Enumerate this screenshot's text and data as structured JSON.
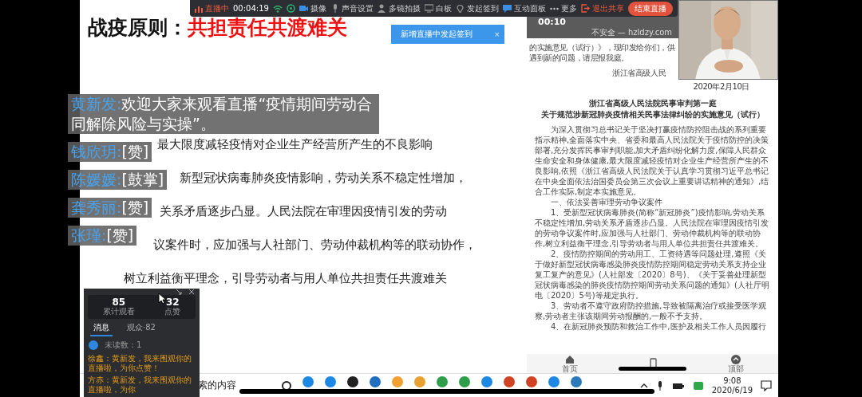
{
  "toolbar": {
    "live_status": "直播中",
    "elapsed": "00:04:19",
    "items": [
      {
        "label": "摄像"
      },
      {
        "label": "声音设置"
      },
      {
        "label": "多镜拍摄"
      },
      {
        "label": "白板"
      },
      {
        "label": "发起签到"
      },
      {
        "label": "互动面板"
      },
      {
        "label": "更多"
      }
    ],
    "exit_share": "退出共享",
    "end_button": "结束直播"
  },
  "notification": {
    "text": "新增直播中发起签到",
    "close": "×"
  },
  "slide": {
    "title": "战疫原则：",
    "title_highlight": "共担责任共渡难关",
    "lines": [
      "最大限度减轻疫情对企业生产经营所产生的不良影响",
      "新型冠状病毒肺炎疫情影响，劳动关系不稳定性增加，",
      "关系矛盾逐步凸显。人民法院在审理因疫情引发的劳动",
      "议案件时，应加强与人社部门、劳动仲裁机构等的联动协作，",
      "树立利益衡平理念，引导劳动者与用人单位共担责任共渡难关"
    ]
  },
  "comments": [
    {
      "name": "黄新发:",
      "text": "欢迎大家来观看直播“疫情期间劳动合同解除风险与实操”。"
    },
    {
      "name": "钱欣玥:",
      "text": "[赞]"
    },
    {
      "name": "陈媛媛:",
      "text": "[鼓掌]"
    },
    {
      "name": "龚秀丽:",
      "text": "[赞]"
    },
    {
      "name": "张瑾:",
      "text": "[赞]"
    }
  ],
  "document": {
    "timer": "00:10",
    "address": "不安全 — hzldzy.com",
    "intro_lines": [
      "的实施意见（试行）》，现印发给你们，供",
      "遇到新的问题，请层报我庭。"
    ],
    "signature": "浙江省高级人民",
    "date": "2020年2月10日",
    "title_lines": [
      "浙江省高级人民法院民事审判第一庭",
      "关于规范涉新冠肺炎疫情相关民事法律纠纷的实施意见（试行）"
    ],
    "paragraphs": [
      "为深入贯彻习总书记关于坚决打赢疫情防控阻击战的系列重要指示精神,全面落实中央、省委和最高人民法院关于疫情防控的决策部署,充分发挥民事审判职能,加大矛盾纠纷化解力度,保障人民群众生命安全和身体健康,最大限度减轻疫情对企业生产经营所产生的不良影响,依照《浙江省高级人民法院关于认真学习贯彻习近平总书记在中央全面依法治国委员会第三次会议上重要讲话精神的通知》,结合工作实际,制定本实施意见。",
      "一、依法妥善审理劳动争议案件",
      "1、受新型冠状病毒肺炎(简称“新冠肺炎”)疫情影响,劳动关系不稳定性增加,劳动关系矛盾逐步凸显。人民法院在审理因疫情引发的劳动争议案件时,应加强与人社部门、劳动仲裁机构等的联动协作,树立利益衡平理念,引导劳动者与用人单位共担责任共渡难关。",
      "2、疫情防控期间的劳动用工、工资待遇等问题处理,遵照《关于做好新型冠状病毒感染肺炎疫情防控期间稳定劳动关系支持企业复工复产的意见》(人社部发〔2020〕8号)、《关于妥善处理新型冠状病毒感染的肺炎疫情防控期间劳动关系问题的通知》(人社厅明电〔2020〕5号)等规定执行。",
      "3、劳动者不遵守政府防控措施,导致被隔离治疗或接受医学观察,劳动者主张该期间劳动报酬的,一般不予支持。",
      "4、在新冠肺炎预防和救治工作中,医护及相关工作人员因履行"
    ],
    "nav": [
      {
        "kind": "home",
        "label": "首页"
      },
      {
        "kind": "phone"
      },
      {
        "kind": "top",
        "label": "顶部"
      }
    ]
  },
  "chat_panel": {
    "stats": [
      {
        "value": "85",
        "label": "累计观看"
      },
      {
        "value": "32",
        "label": "点赞"
      }
    ],
    "tabs": [
      {
        "label": "消息",
        "selected": true
      },
      {
        "label": "观众·82",
        "selected": false
      }
    ],
    "unread": "未读数：1",
    "messages": [
      "徐鑫：黄新发，我来围观你的直播啦，为你点赞！",
      "方赤：黄新发，我来围观你的直播啦，为你"
    ]
  },
  "taskbar": {
    "search_text": "索的内容",
    "time": "9:08",
    "date": "2020/6/19"
  }
}
